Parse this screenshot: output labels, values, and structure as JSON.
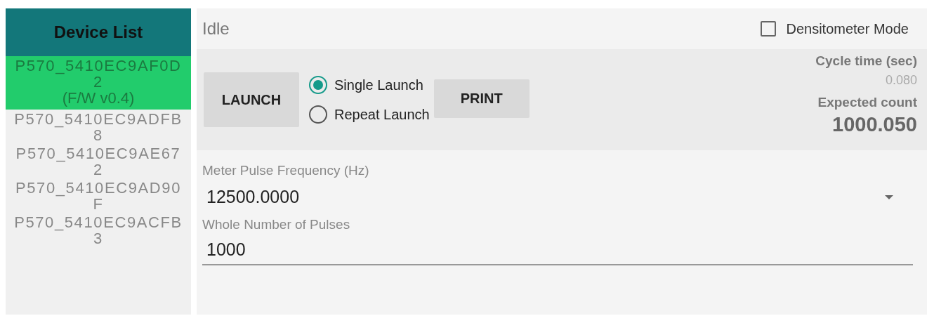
{
  "device_list": {
    "title": "Device List",
    "items": [
      {
        "name": "P570_5410EC9AF0D2",
        "firmware": "(F/W v0.4)",
        "selected": true
      },
      {
        "name": "P570_5410EC9ADFB8",
        "selected": false
      },
      {
        "name": "P570_5410EC9AE672",
        "selected": false
      },
      {
        "name": "P570_5410EC9AD90F",
        "selected": false
      },
      {
        "name": "P570_5410EC9ACFB3",
        "selected": false
      }
    ]
  },
  "status": "Idle",
  "densitometer_mode": {
    "label": "Densitometer Mode",
    "checked": false
  },
  "launch_button": "LAUNCH",
  "launch_modes": [
    {
      "label": "Single Launch",
      "selected": true
    },
    {
      "label": "Repeat Launch",
      "selected": false
    }
  ],
  "print_button": "PRINT",
  "cycle_time": {
    "label": "Cycle time (sec)",
    "value": "0.080"
  },
  "expected_count": {
    "label": "Expected count",
    "value": "1000.050"
  },
  "frequency": {
    "label": "Meter Pulse Frequency (Hz)",
    "value": "12500.0000"
  },
  "pulses": {
    "label": "Whole Number of Pulses",
    "value": "1000"
  }
}
